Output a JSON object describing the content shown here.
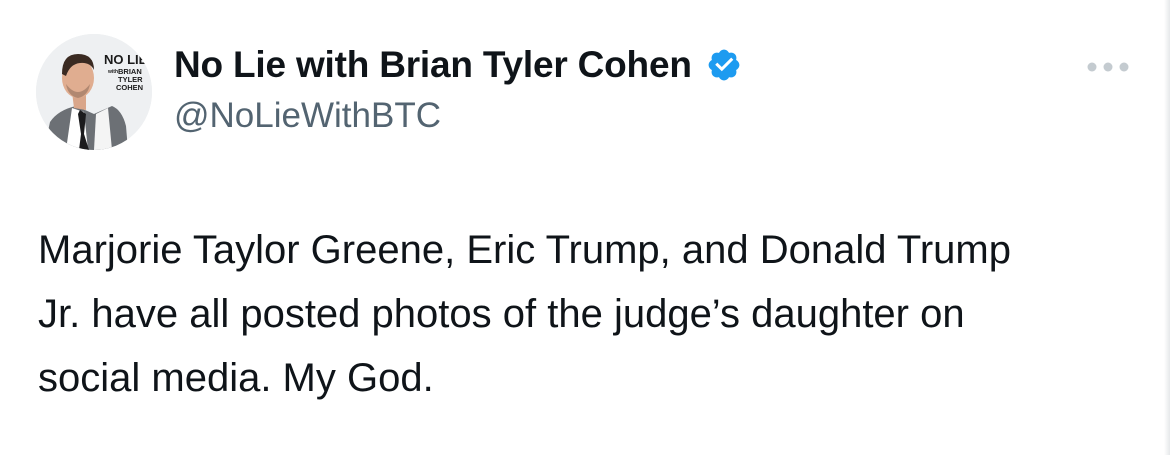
{
  "author": {
    "display_name": "No Lie with Brian Tyler Cohen",
    "handle": "@NoLieWithBTC",
    "verified": true,
    "verified_color": "#1d9bf0",
    "avatar": {
      "logo_lines": [
        "NO LIE",
        "with",
        "BRIAN",
        "TYLER",
        "COHEN"
      ]
    }
  },
  "tweet": {
    "text": "Marjorie Taylor Greene, Eric Trump, and Donald Trump\nJr. have all posted photos of the judge’s daughter on\nsocial media. My God."
  },
  "icons": {
    "verified": "verified-badge-icon",
    "more": "more-options-icon"
  },
  "colors": {
    "text_primary": "#0f1419",
    "text_secondary": "#536471",
    "background": "#ffffff"
  }
}
